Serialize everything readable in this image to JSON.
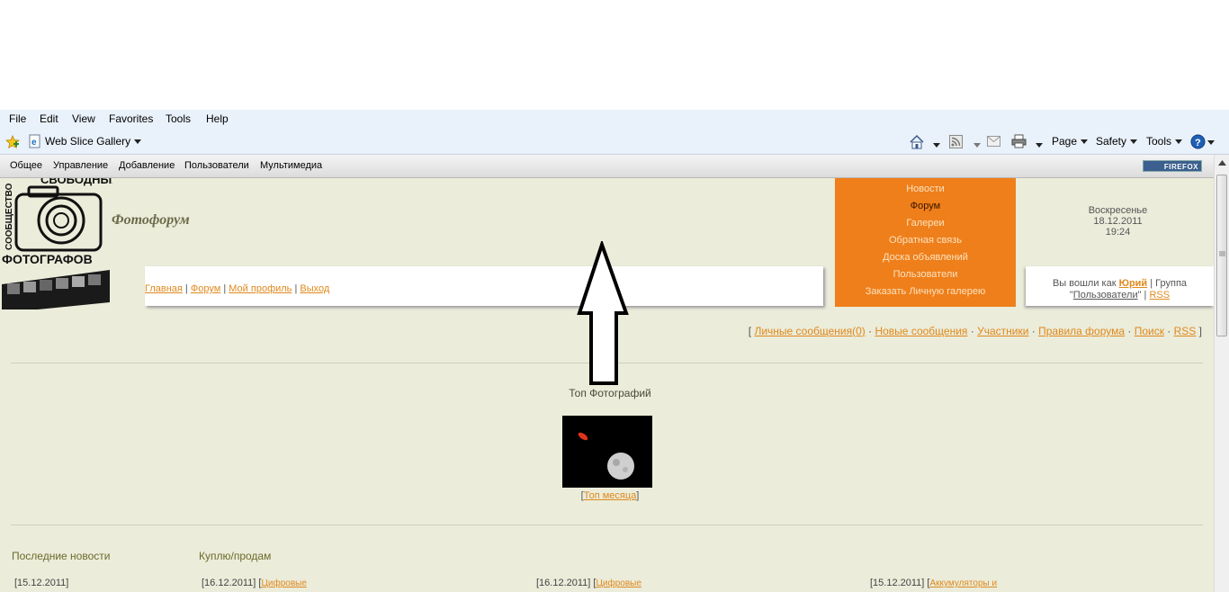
{
  "browser": {
    "menu": [
      "File",
      "Edit",
      "View",
      "Favorites",
      "Tools",
      "Help"
    ],
    "favorites": {
      "web_slice": "Web Slice Gallery"
    },
    "command_bar": {
      "page": "Page",
      "safety": "Safety",
      "tools": "Tools"
    }
  },
  "site": {
    "topnav": [
      "Общее",
      "Управление",
      "Добавление",
      "Пользователи",
      "Мультимедиа"
    ],
    "firefox_badge": "FIREFOX",
    "logo": {
      "line1": "СВОБОДНЫХ",
      "line2": "ФОТОГРАФОВ",
      "vertical": "СООБЩЕСТВО"
    },
    "title": "Фотофорум",
    "breadcrumb": [
      "Главная",
      "Форум",
      "Мой профиль",
      "Выход"
    ],
    "orange_menu": [
      "Новости",
      "Форум",
      "Галереи",
      "Обратная связь",
      "Доска объявлений",
      "Пользователи",
      "Заказать Личную галерею"
    ],
    "date": {
      "day": "Воскресенье",
      "date": "18.12.2011",
      "time": "19:24"
    },
    "user": {
      "prefix": "Вы вошли как",
      "name": "Юрий",
      "group_label": "| Группа",
      "group": "Пользователи",
      "rss": "RSS"
    },
    "forum_links": [
      "Личные сообщения(0)",
      "Новые сообщения",
      "Участники",
      "Правила форума",
      "Поиск",
      "RSS"
    ],
    "top_photos": {
      "title": "Топ Фотографий",
      "link": "Топ месяца"
    },
    "sections": {
      "news": "Последние новости",
      "buysell": "Куплю/продам"
    },
    "news_items": [
      {
        "date": "[15.12.2011]",
        "link": ""
      },
      {
        "date": "[16.12.2011]",
        "link": "Цифровые"
      },
      {
        "date": "[16.12.2011]",
        "link": "Цифровые"
      },
      {
        "date": "[15.12.2011]",
        "link": "Аккумуляторы и"
      }
    ]
  }
}
